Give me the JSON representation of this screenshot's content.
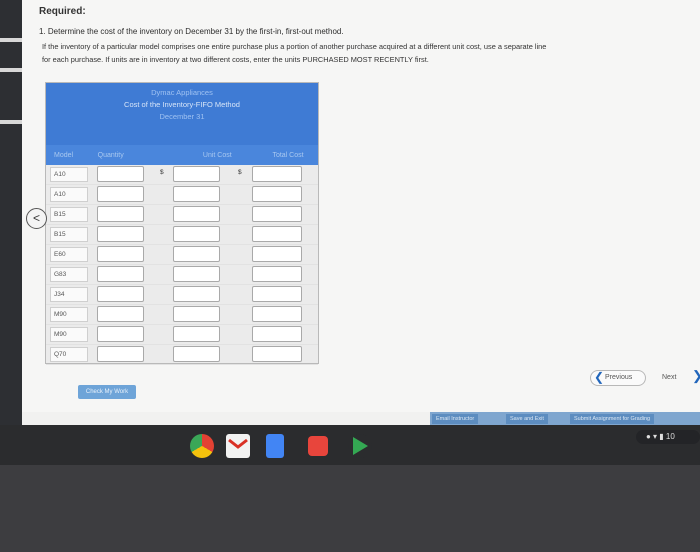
{
  "question": {
    "required_label": "Required:",
    "item_text": "1. Determine the cost of the inventory on December 31 by the first-in, first-out method.",
    "instruction_line1": "If the inventory of a particular model comprises one entire purchase plus a portion of another purchase acquired at a different unit cost, use a separate line",
    "instruction_line2": "for each purchase. If units are in inventory at two different costs, enter the units PURCHASED MOST RECENTLY first."
  },
  "table": {
    "company": "Dymac Appliances",
    "title": "Cost of the Inventory-FIFO Method",
    "date": "December 31",
    "col_model": "Model",
    "col_quantity": "Quantity",
    "col_unit_cost": "Unit Cost",
    "col_total_cost": "Total Cost",
    "currency_symbol": "$",
    "rows": [
      "A10",
      "A10",
      "B15",
      "B15",
      "E60",
      "G83",
      "J34",
      "M90",
      "M90",
      "Q70"
    ]
  },
  "nav": {
    "back_symbol": "<",
    "previous_label": "Previous",
    "next_label": "Next",
    "check_label": "Check My Work"
  },
  "footer_buttons": {
    "email": "Email Instructor",
    "save": "Save and Exit",
    "submit": "Submit Assignment for Grading"
  },
  "system_tray": {
    "time_fragment": "10"
  },
  "colors": {
    "header_blue": "#3f7bd4",
    "link_blue": "#2266bb"
  }
}
